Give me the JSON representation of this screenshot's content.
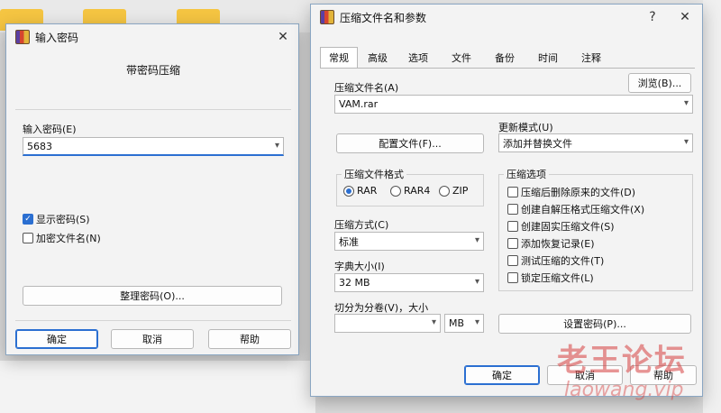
{
  "pwd_dialog": {
    "title": "输入密码",
    "heading": "带密码压缩",
    "enter_label": "输入密码(E)",
    "password_value": "5683",
    "show_password": "显示密码(S)",
    "encrypt_names": "加密文件名(N)",
    "organize": "整理密码(O)...",
    "ok": "确定",
    "cancel": "取消",
    "help": "帮助",
    "close_glyph": "✕"
  },
  "main_dialog": {
    "title": "压缩文件名和参数",
    "help_glyph": "?",
    "close_glyph": "✕",
    "tabs": [
      "常规",
      "高级",
      "选项",
      "文件",
      "备份",
      "时间",
      "注释"
    ],
    "archive_name_label": "压缩文件名(A)",
    "browse": "浏览(B)...",
    "archive_name": "VAM.rar",
    "profiles": "配置文件(F)...",
    "update_mode_label": "更新模式(U)",
    "update_mode": "添加并替换文件",
    "format_group": "压缩文件格式",
    "formats": [
      "RAR",
      "RAR4",
      "ZIP"
    ],
    "method_label": "压缩方式(C)",
    "method": "标准",
    "dict_label": "字典大小(I)",
    "dict": "32 MB",
    "split_label": "切分为分卷(V)，大小",
    "split_unit": "MB",
    "options_group": "压缩选项",
    "options": [
      "压缩后删除原来的文件(D)",
      "创建自解压格式压缩文件(X)",
      "创建固实压缩文件(S)",
      "添加恢复记录(E)",
      "测试压缩的文件(T)",
      "锁定压缩文件(L)"
    ],
    "set_password": "设置密码(P)...",
    "ok": "确定",
    "cancel": "取消",
    "help": "帮助"
  },
  "watermark": {
    "text": "老王论坛",
    "url": "laowang.vip"
  }
}
